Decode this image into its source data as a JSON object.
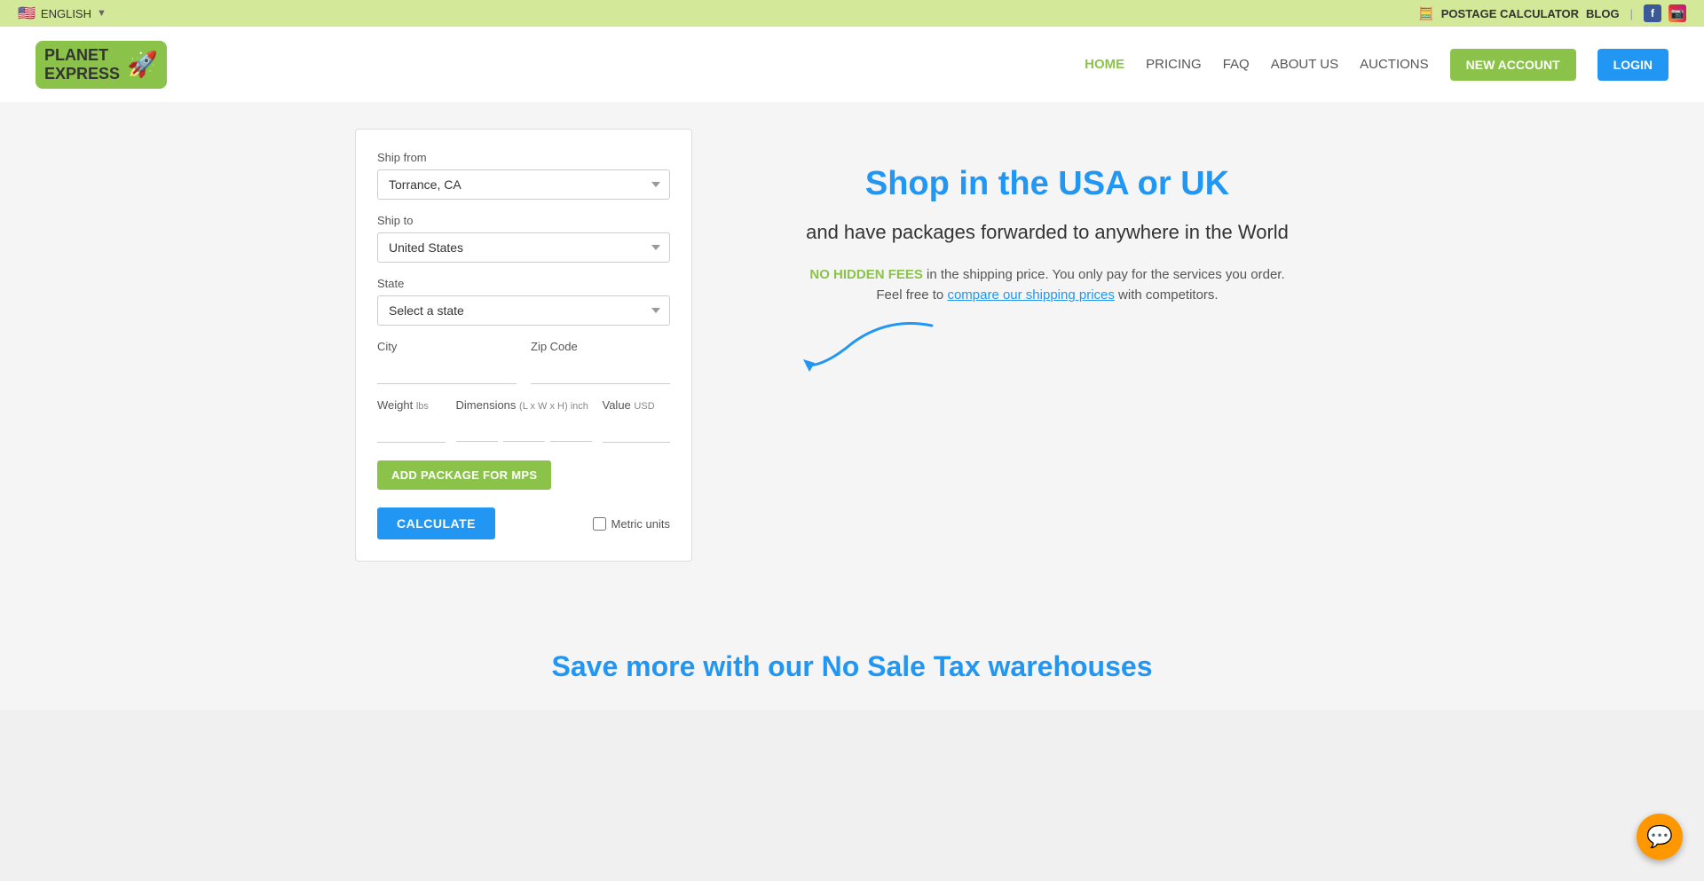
{
  "topbar": {
    "language": "ENGLISH",
    "postage_calculator": "POSTAGE CALCULATOR",
    "blog": "BLOG"
  },
  "header": {
    "logo_line1": "PLANET",
    "logo_line2": "EXPRESS",
    "nav": {
      "home": "HOME",
      "pricing": "PRICING",
      "faq": "FAQ",
      "about_us": "ABOUT US",
      "auctions": "AUCTIONS"
    },
    "new_account_btn": "NEW ACCOUNT",
    "login_btn": "LOGIN"
  },
  "calculator": {
    "ship_from_label": "Ship from",
    "ship_from_value": "Torrance, CA",
    "ship_to_label": "Ship to",
    "ship_to_value": "United States",
    "state_label": "State",
    "state_placeholder": "Select a state",
    "city_label": "City",
    "zip_label": "Zip Code",
    "weight_label": "Weight",
    "weight_unit": "lbs",
    "dims_label": "Dimensions",
    "dims_unit": "(L x W x H) inch",
    "value_label": "Value",
    "value_unit": "USD",
    "add_package_btn": "ADD PACKAGE FOR MPS",
    "calculate_btn": "CALCULATE",
    "metric_units_label": "Metric units"
  },
  "hero": {
    "title": "Shop in the USA or UK",
    "subtitle": "and have packages forwarded to anywhere in the World",
    "fees_highlight": "NO HIDDEN FEES",
    "fees_text": "in the shipping price. You only pay for the services you order.",
    "compare_text": "Feel free to",
    "compare_link": "compare our shipping prices",
    "compare_suffix": "with competitors."
  },
  "save_more": {
    "title": "Save more with our No Sale Tax warehouses"
  },
  "chat": {
    "icon": "💬"
  }
}
